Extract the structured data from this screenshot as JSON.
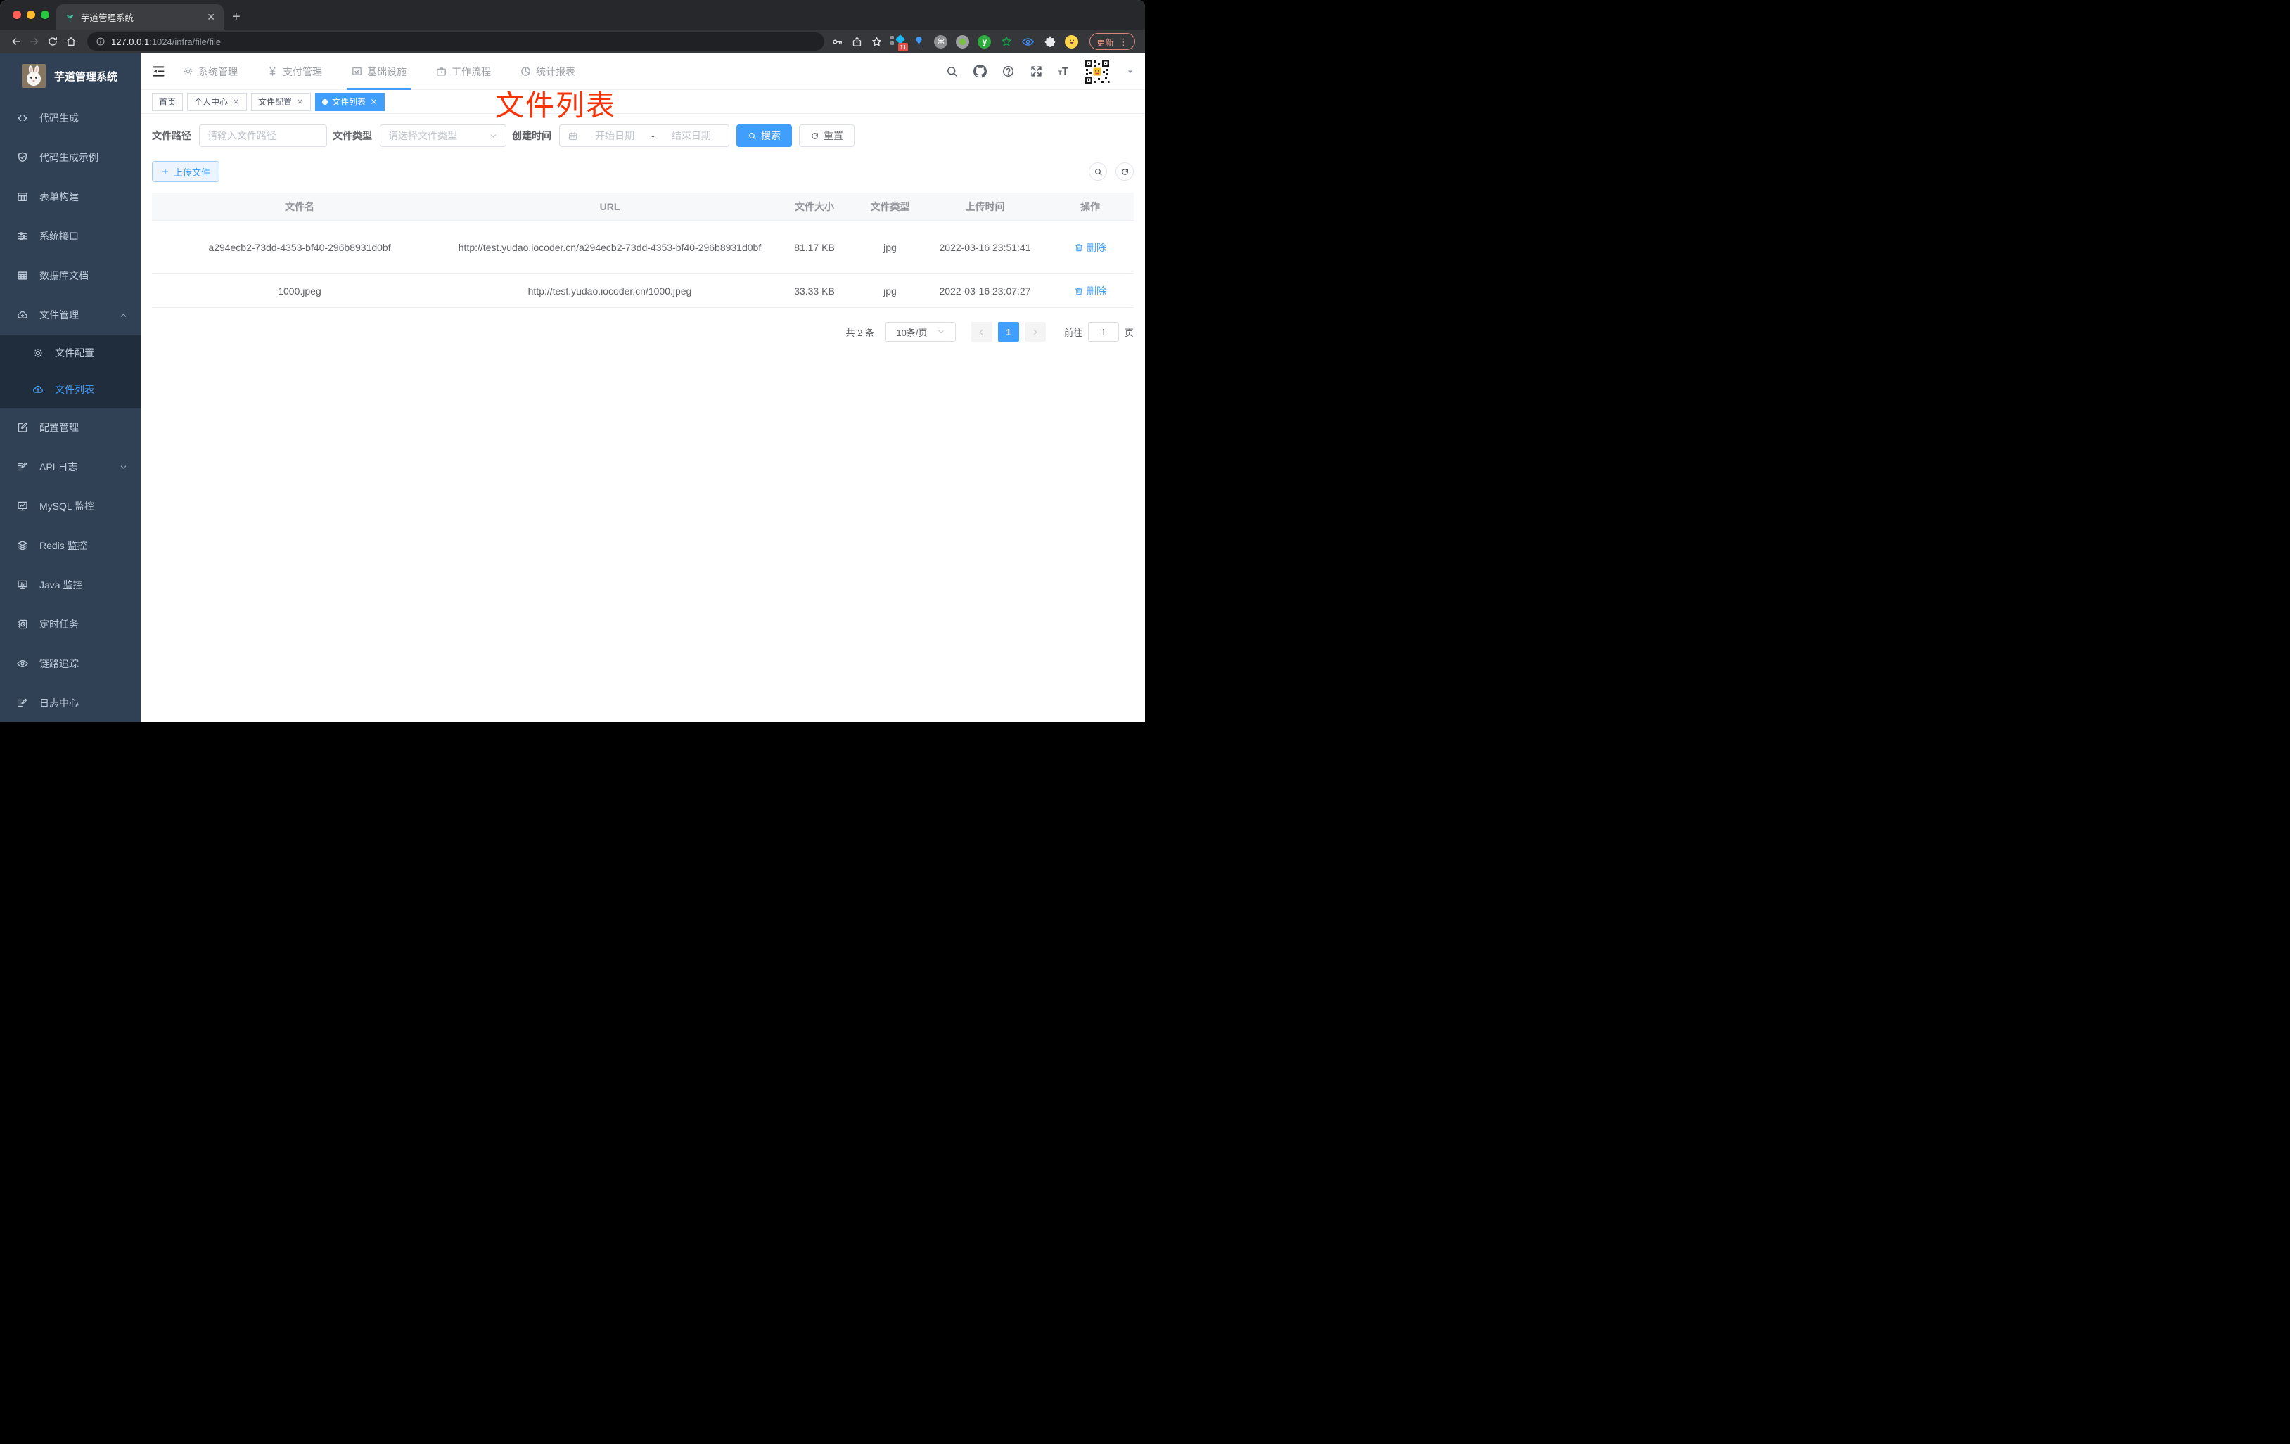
{
  "browser": {
    "tab_title": "芋道管理系统",
    "url_host": "127.0.0.1",
    "url_path": ":1024/infra/file/file",
    "extension_badge": "11",
    "update_label": "更新"
  },
  "header": {
    "nav": [
      {
        "label": "系统管理"
      },
      {
        "label": "支付管理"
      },
      {
        "label": "基础设施",
        "active": true
      },
      {
        "label": "工作流程"
      },
      {
        "label": "统计报表"
      }
    ]
  },
  "sidebar": {
    "title": "芋道管理系统",
    "items": [
      {
        "label": "代码生成"
      },
      {
        "label": "代码生成示例"
      },
      {
        "label": "表单构建"
      },
      {
        "label": "系统接口"
      },
      {
        "label": "数据库文档"
      },
      {
        "label": "文件管理",
        "expanded": true,
        "children": [
          {
            "label": "文件配置"
          },
          {
            "label": "文件列表",
            "active": true
          }
        ]
      },
      {
        "label": "配置管理"
      },
      {
        "label": "API 日志",
        "expanded": false
      },
      {
        "label": "MySQL 监控"
      },
      {
        "label": "Redis 监控"
      },
      {
        "label": "Java 监控"
      },
      {
        "label": "定时任务"
      },
      {
        "label": "链路追踪"
      },
      {
        "label": "日志中心"
      }
    ]
  },
  "tags": [
    {
      "label": "首页",
      "closable": false,
      "active": false
    },
    {
      "label": "个人中心",
      "closable": true,
      "active": false
    },
    {
      "label": "文件配置",
      "closable": true,
      "active": false
    },
    {
      "label": "文件列表",
      "closable": true,
      "active": true
    }
  ],
  "filters": {
    "file_path_label": "文件路径",
    "file_path_placeholder": "请输入文件路径",
    "file_type_label": "文件类型",
    "file_type_placeholder": "请选择文件类型",
    "create_time_label": "创建时间",
    "start_placeholder": "开始日期",
    "range_separator": "-",
    "end_placeholder": "结束日期",
    "search_label": "搜索",
    "reset_label": "重置"
  },
  "toolbar": {
    "upload_label": "上传文件"
  },
  "table": {
    "columns": [
      "文件名",
      "URL",
      "文件大小",
      "文件类型",
      "上传时间",
      "操作"
    ],
    "rows": [
      {
        "name": "a294ecb2-73dd-4353-bf40-296b8931d0bf",
        "url": "http://test.yudao.iocoder.cn/a294ecb2-73dd-4353-bf40-296b8931d0bf",
        "size": "81.17 KB",
        "type": "jpg",
        "time": "2022-03-16 23:51:41",
        "action": "删除"
      },
      {
        "name": "1000.jpeg",
        "url": "http://test.yudao.iocoder.cn/1000.jpeg",
        "size": "33.33 KB",
        "type": "jpg",
        "time": "2022-03-16 23:07:27",
        "action": "删除"
      }
    ]
  },
  "pagination": {
    "total": "共 2 条",
    "size": "10条/页",
    "page": "1",
    "goto": "前往",
    "goto_value": "1",
    "unit": "页"
  },
  "annotation": {
    "text": "文件列表",
    "color": "#f93305"
  },
  "colors": {
    "accent": "#409eff",
    "sidebar_bg": "#304156",
    "submenu_bg": "#1f2d3d",
    "sidebar_text": "#bfcbd9",
    "active_tab_bg": "#409eff"
  }
}
